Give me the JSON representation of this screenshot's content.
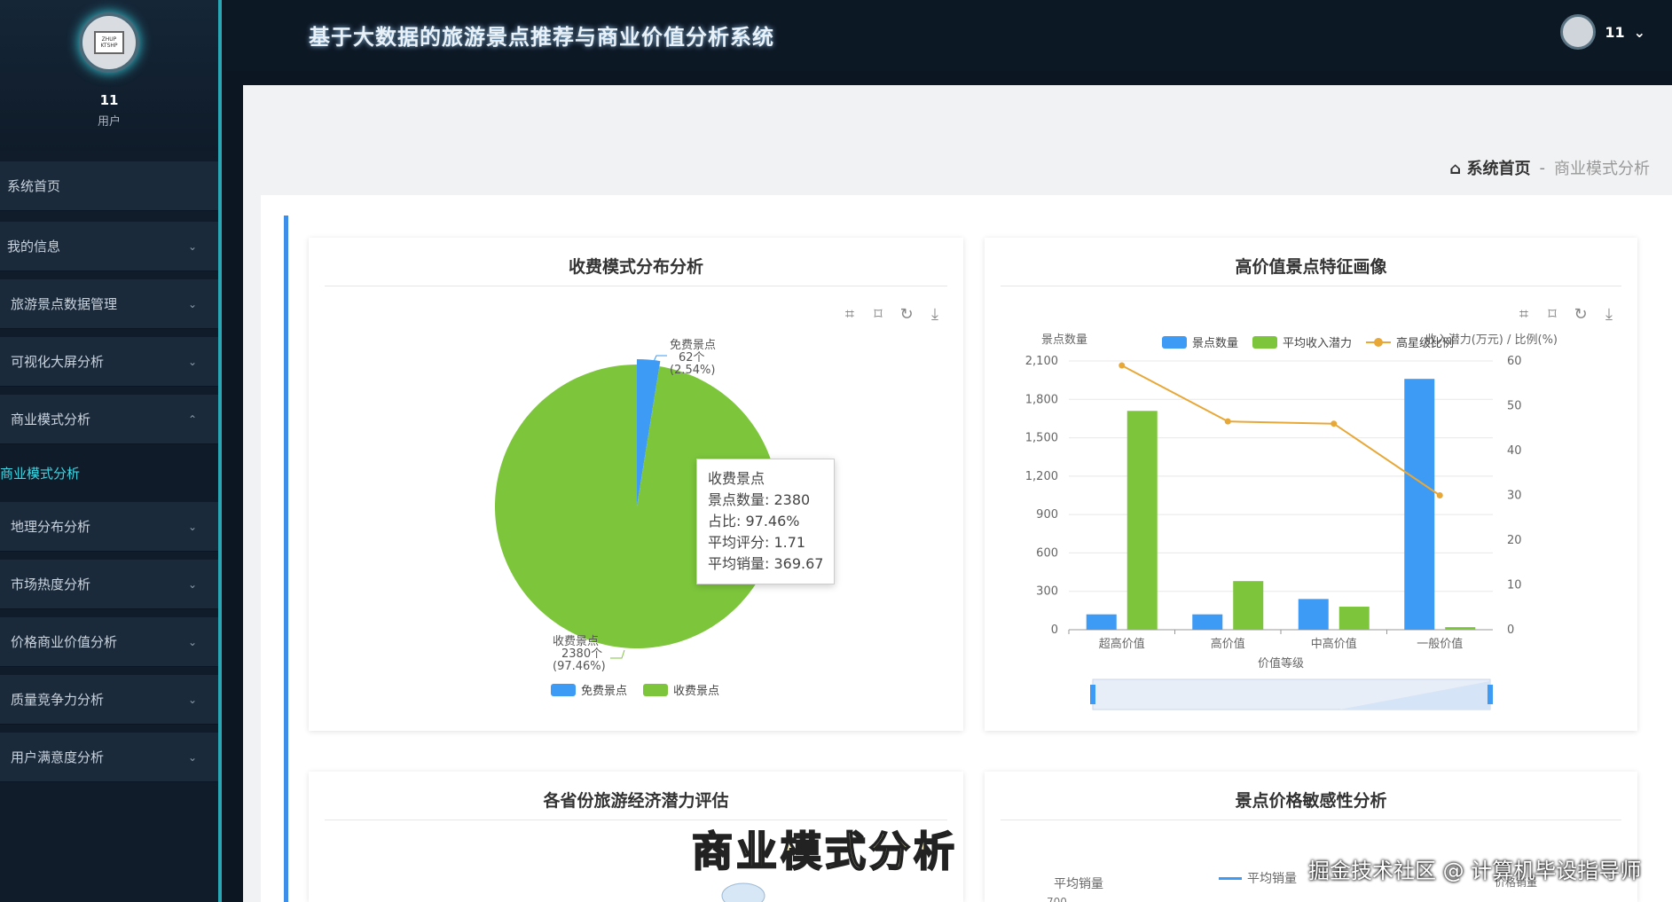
{
  "app": {
    "title": "基于大数据的旅游景点推荐与商业价值分析系统"
  },
  "user": {
    "name": "11",
    "role": "用户",
    "avatar_text": "ZHUP KTSHP"
  },
  "header": {
    "username": "11",
    "dropdown_icon": "chevron-down-icon"
  },
  "sidebar": {
    "items": [
      {
        "label": "系统首页"
      },
      {
        "label": "我的信息"
      },
      {
        "label": "旅游景点数据管理"
      },
      {
        "label": "可视化大屏分析"
      },
      {
        "label": "商业模式分析"
      },
      {
        "label": "商业模式分析"
      },
      {
        "label": "地理分布分析"
      },
      {
        "label": "市场热度分析"
      },
      {
        "label": "价格商业价值分析"
      },
      {
        "label": "质量竞争力分析"
      },
      {
        "label": "用户满意度分析"
      }
    ]
  },
  "breadcrumb": {
    "home": "系统首页",
    "sep": "-",
    "current": "商业模式分析"
  },
  "cards": {
    "pie_title": "收费模式分布分析",
    "bar_title": "高价值景点特征画像",
    "province_title": "各省份旅游经济潜力评估",
    "price_title": "景点价格敏感性分析"
  },
  "tooltip": {
    "name": "收费景点",
    "line1": "景点数量: 2380",
    "line2": "占比: 97.46%",
    "line3": "平均评分: 1.71",
    "line4": "平均销量: 369.67"
  },
  "chart_data": [
    {
      "type": "pie",
      "title": "收费模式分布分析",
      "slices": [
        {
          "name": "免费景点",
          "value": 62,
          "unit": "个",
          "percent": "2.54%",
          "color": "#3e9bf5"
        },
        {
          "name": "收费景点",
          "value": 2380,
          "unit": "个",
          "percent": "97.46%",
          "color": "#7dc63c"
        }
      ],
      "legend": [
        "免费景点",
        "收费景点"
      ],
      "legend_position": "bottom"
    },
    {
      "type": "bar",
      "title": "高价值景点特征画像",
      "categories": [
        "超高价值",
        "高价值",
        "中高价值",
        "一般价值"
      ],
      "xlabel": "价值等级",
      "ylabel_left": "景点数量",
      "ylabel_right": "收入潜力(万元) / 比例(%)",
      "ylim_left": [
        0,
        2100
      ],
      "yticks_left": [
        "0",
        "300",
        "600",
        "900",
        "1,200",
        "1,500",
        "1,800",
        "2,100"
      ],
      "ylim_right": [
        0,
        60
      ],
      "yticks_right": [
        "0",
        "10",
        "20",
        "30",
        "40",
        "50",
        "60"
      ],
      "series": [
        {
          "name": "景点数量",
          "kind": "bar",
          "axis": "left",
          "color": "#3e9bf5",
          "values": [
            120,
            120,
            240,
            1960
          ]
        },
        {
          "name": "平均收入潜力",
          "kind": "bar",
          "axis": "left",
          "color": "#7dc63c",
          "values": [
            1710,
            380,
            180,
            20
          ]
        },
        {
          "name": "高星级比例",
          "kind": "line",
          "axis": "right",
          "color": "#e8a838",
          "values": [
            59,
            46.5,
            46,
            30
          ]
        }
      ],
      "legend_position": "top"
    }
  ],
  "price_chart": {
    "ylabel": "平均销量",
    "legend": "平均销量",
    "legend2": "价格销量",
    "tick": "700"
  },
  "overlay": {
    "caption": "商业模式分析",
    "credit": "掘金技术社区 @ 计算机毕设指导师"
  },
  "toolbox_icons": [
    "zoom-icon",
    "zoom-reset-icon",
    "restore-icon",
    "download-icon"
  ],
  "colors": {
    "accent": "#2aa7b5",
    "sidebar_bg": "#101c2a",
    "free": "#3e9bf5",
    "paid": "#7dc63c",
    "line": "#e8a838"
  }
}
